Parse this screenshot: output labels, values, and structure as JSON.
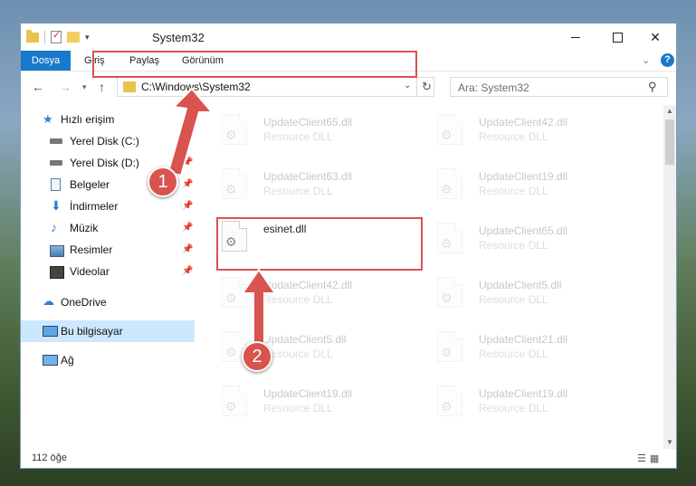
{
  "window": {
    "title": "System32",
    "controls": {
      "minimize": "",
      "maximize": "",
      "close": "✕"
    }
  },
  "ribbon": {
    "tabs": [
      {
        "label": "Dosya"
      },
      {
        "label": "Giriş"
      },
      {
        "label": "Paylaş"
      },
      {
        "label": "Görünüm"
      }
    ],
    "help_label": "?"
  },
  "nav": {
    "address": "C:\\Windows\\System32",
    "search_placeholder": "Ara: System32"
  },
  "sidebar": {
    "items": [
      {
        "label": "Hızlı erişim",
        "icon": "star-icon",
        "pinned": false
      },
      {
        "label": "Yerel Disk (C:)",
        "icon": "drive-icon",
        "pinned": true
      },
      {
        "label": "Yerel Disk (D:)",
        "icon": "drive-icon",
        "pinned": true
      },
      {
        "label": "Belgeler",
        "icon": "documents-icon",
        "pinned": true
      },
      {
        "label": "İndirmeler",
        "icon": "download-icon",
        "pinned": true
      },
      {
        "label": "Müzik",
        "icon": "music-icon",
        "pinned": true
      },
      {
        "label": "Resimler",
        "icon": "pictures-icon",
        "pinned": true
      },
      {
        "label": "Videolar",
        "icon": "video-icon",
        "pinned": true
      },
      {
        "label": "OneDrive",
        "icon": "cloud-icon",
        "pinned": false
      },
      {
        "label": "Bu bilgisayar",
        "icon": "computer-icon",
        "pinned": false,
        "selected": true
      },
      {
        "label": "Ağ",
        "icon": "network-icon",
        "pinned": false
      }
    ]
  },
  "files": {
    "left": [
      {
        "name": "UpdateClient65.dll",
        "desc": "Resource DLL"
      },
      {
        "name": "UpdateClient63.dll",
        "desc": "Resource DLL"
      },
      {
        "name": "esinet.dll",
        "desc": ""
      },
      {
        "name": "UpdateClient42.dll",
        "desc": "Resource DLL"
      },
      {
        "name": "UpdateClient5.dll",
        "desc": "Resource DLL"
      },
      {
        "name": "UpdateClient19.dll",
        "desc": "Resource DLL"
      }
    ],
    "right": [
      {
        "name": "UpdateClient42.dll",
        "desc": "Resource DLL"
      },
      {
        "name": "UpdateClient19.dll",
        "desc": "Resource DLL"
      },
      {
        "name": "UpdateClient65.dll",
        "desc": "Resource DLL"
      },
      {
        "name": "UpdateClient5.dll",
        "desc": "Resource DLL"
      },
      {
        "name": "UpdateClient21.dll",
        "desc": "Resource DLL"
      },
      {
        "name": "UpdateClient19.dll",
        "desc": "Resource DLL"
      }
    ]
  },
  "status": {
    "count": "112 öğe"
  },
  "callouts": {
    "one": "1",
    "two": "2"
  },
  "colors": {
    "accent": "#1979ca",
    "highlight": "#d9534f",
    "selected": "#cce8ff"
  }
}
